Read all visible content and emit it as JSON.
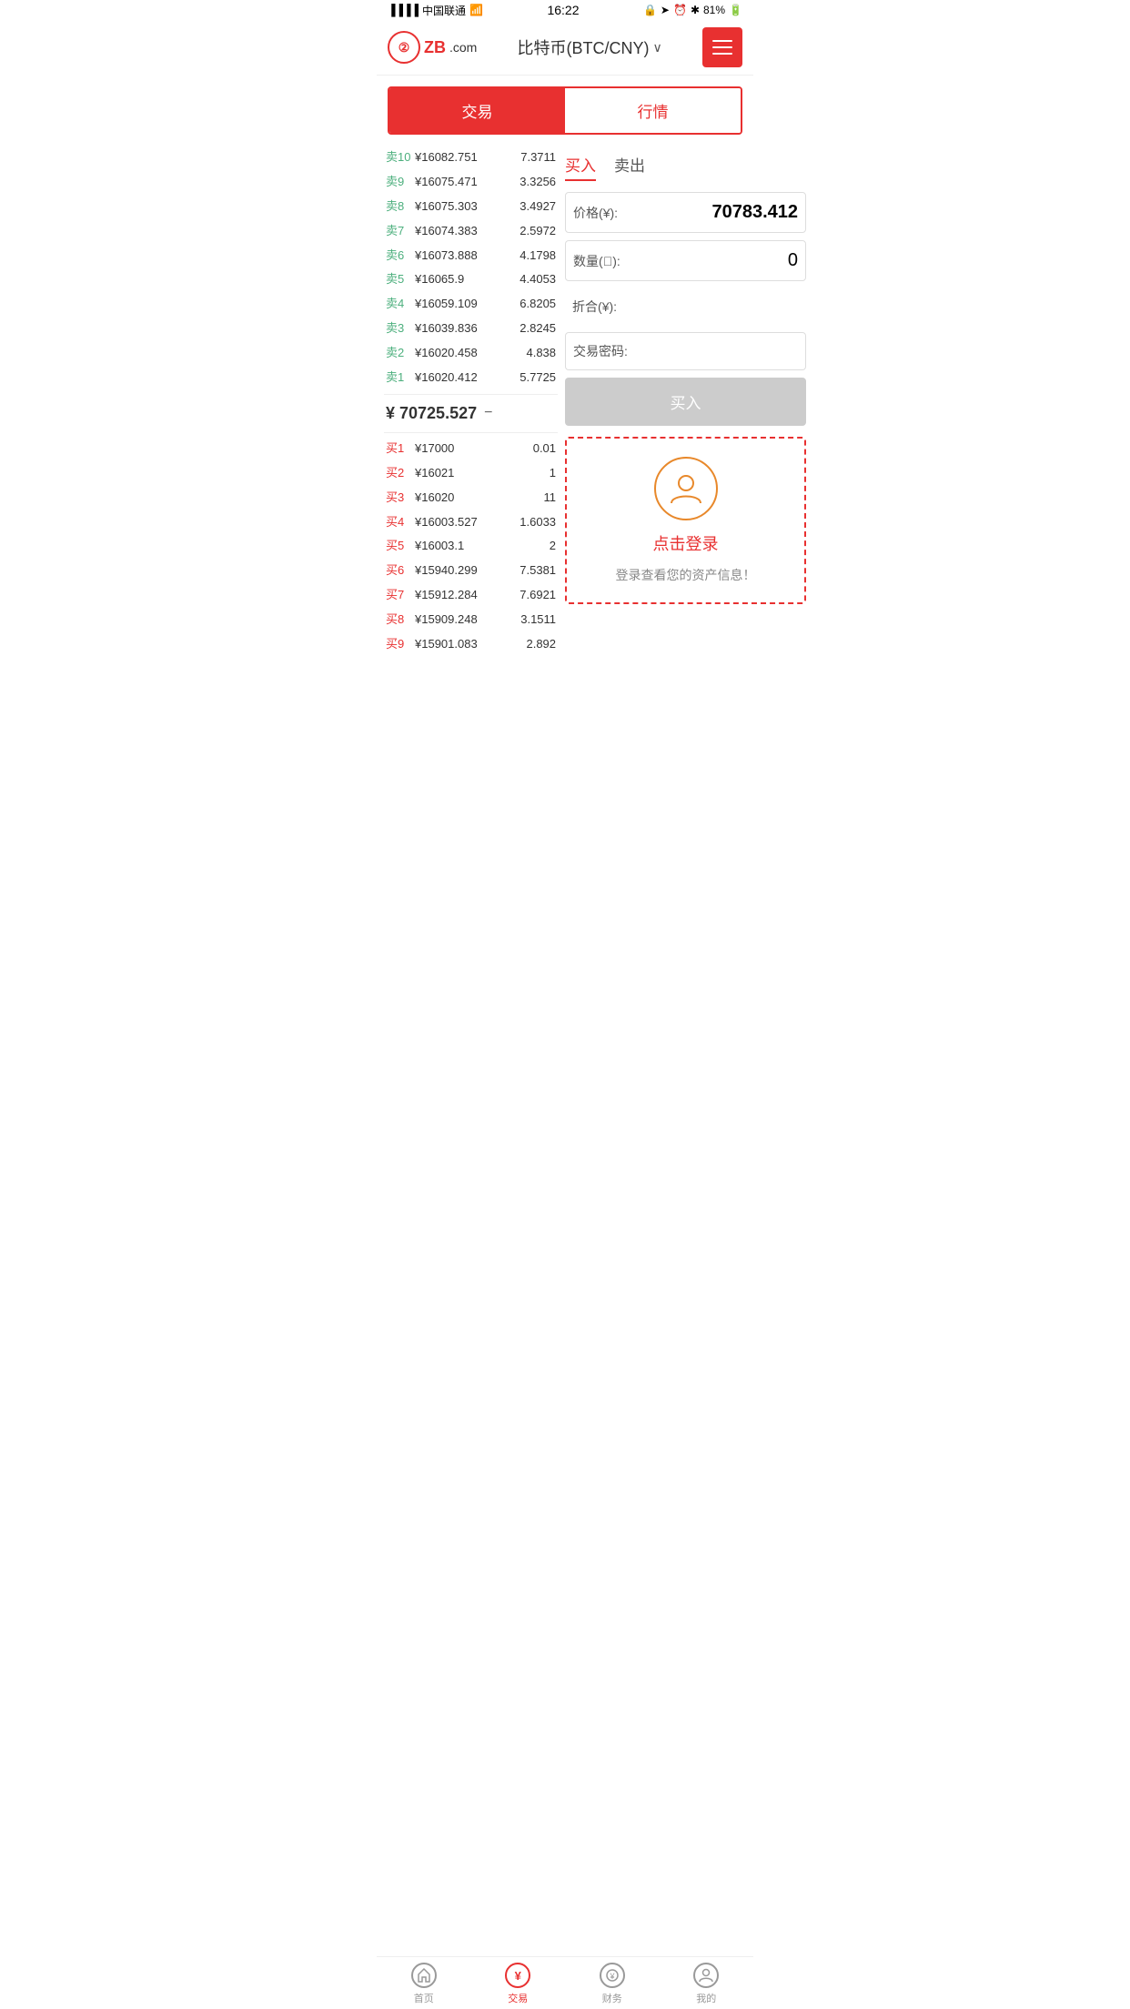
{
  "statusBar": {
    "carrier": "中国联通",
    "time": "16:22",
    "battery": "81%"
  },
  "header": {
    "logoText": "ZB",
    "logoDomain": ".com",
    "title": "比特币(BTC/CNY)",
    "menuIcon": "menu"
  },
  "tabs": [
    {
      "id": "trade",
      "label": "交易",
      "active": true
    },
    {
      "id": "market",
      "label": "行情",
      "active": false
    }
  ],
  "orderBook": {
    "sells": [
      {
        "label": "卖10",
        "price": "¥16082.751",
        "qty": "7.3711"
      },
      {
        "label": "卖9",
        "price": "¥16075.471",
        "qty": "3.3256"
      },
      {
        "label": "卖8",
        "price": "¥16075.303",
        "qty": "3.4927"
      },
      {
        "label": "卖7",
        "price": "¥16074.383",
        "qty": "2.5972"
      },
      {
        "label": "卖6",
        "price": "¥16073.888",
        "qty": "4.1798"
      },
      {
        "label": "卖5",
        "price": "¥16065.9",
        "qty": "4.4053"
      },
      {
        "label": "卖4",
        "price": "¥16059.109",
        "qty": "6.8205"
      },
      {
        "label": "卖3",
        "price": "¥16039.836",
        "qty": "2.8245"
      },
      {
        "label": "卖2",
        "price": "¥16020.458",
        "qty": "4.838"
      },
      {
        "label": "卖1",
        "price": "¥16020.412",
        "qty": "5.7725"
      }
    ],
    "currentPrice": "¥ 70725.527",
    "priceDirection": "−",
    "buys": [
      {
        "label": "买1",
        "price": "¥17000",
        "qty": "0.01"
      },
      {
        "label": "买2",
        "price": "¥16021",
        "qty": "1"
      },
      {
        "label": "买3",
        "price": "¥16020",
        "qty": "11"
      },
      {
        "label": "买4",
        "price": "¥16003.527",
        "qty": "1.6033"
      },
      {
        "label": "买5",
        "price": "¥16003.1",
        "qty": "2"
      },
      {
        "label": "买6",
        "price": "¥15940.299",
        "qty": "7.5381"
      },
      {
        "label": "买7",
        "price": "¥15912.284",
        "qty": "7.6921"
      },
      {
        "label": "买8",
        "price": "¥15909.248",
        "qty": "3.1511"
      },
      {
        "label": "买9",
        "price": "¥15901.083",
        "qty": "2.892"
      }
    ]
  },
  "tradePanel": {
    "buyTab": "买入",
    "sellTab": "卖出",
    "priceLabel": "价格(¥):",
    "priceValue": "70783.412",
    "qtyLabel": "数量(￿):",
    "qtyValue": "0",
    "totalLabel": "折合(¥):",
    "totalValue": "",
    "passwordLabel": "交易密码:",
    "passwordValue": "",
    "buyButton": "买入"
  },
  "loginPrompt": {
    "loginText": "点击登录",
    "assetText": "登录查看您的资产信息！"
  },
  "bottomNav": [
    {
      "id": "home",
      "label": "首页",
      "icon": "★",
      "active": false
    },
    {
      "id": "trade",
      "label": "交易",
      "icon": "¥",
      "active": true
    },
    {
      "id": "finance",
      "label": "财务",
      "icon": "💰",
      "active": false
    },
    {
      "id": "mine",
      "label": "我的",
      "icon": "👤",
      "active": false
    }
  ]
}
